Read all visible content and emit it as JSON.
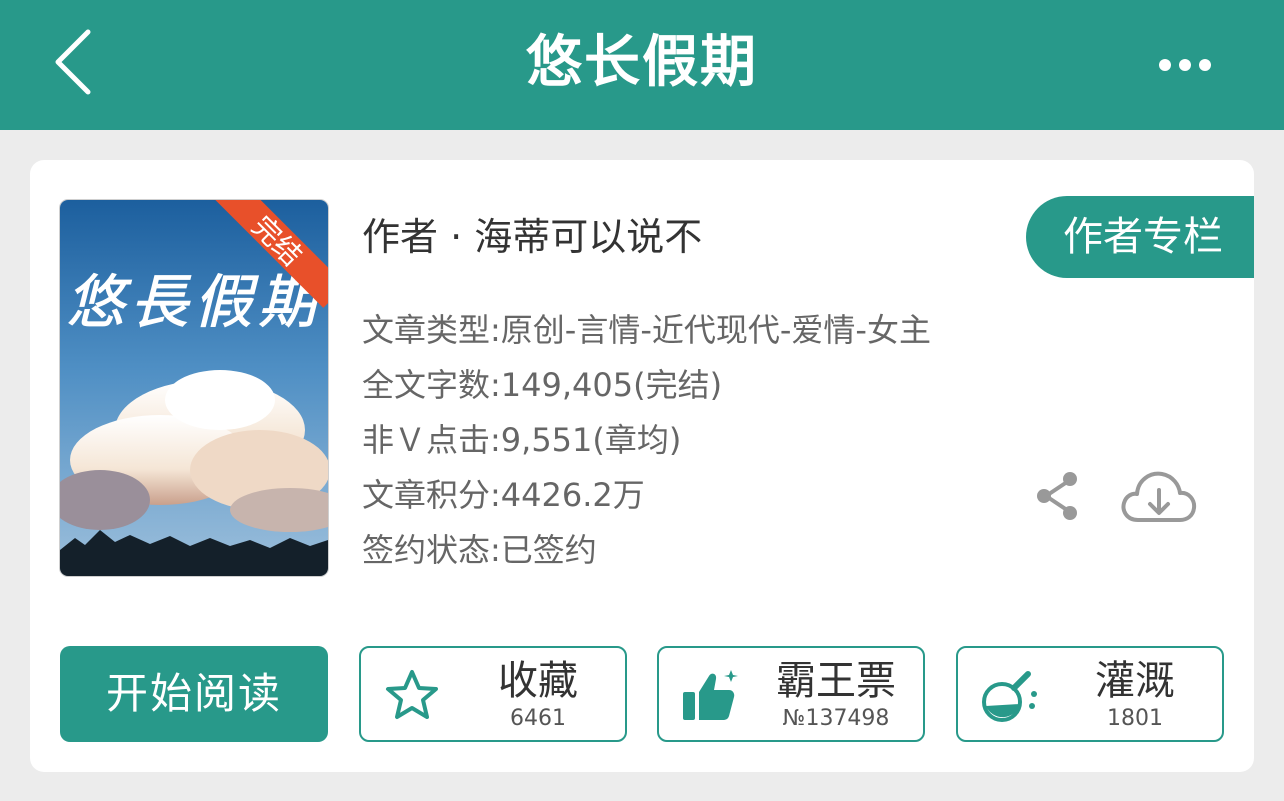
{
  "header": {
    "title": "悠长假期",
    "back_icon": "chevron-left-icon",
    "more_icon": "more-dots-icon"
  },
  "book": {
    "cover_title": "悠長假期",
    "cover_badge": "完结",
    "author_line": "作者 · 海蒂可以说不",
    "author_column_button": "作者专栏",
    "info": {
      "category": "文章类型:原创-言情-近代现代-爱情-女主",
      "word_count": "全文字数:149,405(完结)",
      "clicks": "非Ｖ点击:9,551(章均)",
      "score": "文章积分:4426.2万",
      "sign_status": "签约状态:已签约"
    }
  },
  "actions": {
    "read": "开始阅读",
    "favorite": {
      "label": "收藏",
      "count": "6461",
      "icon": "star-icon"
    },
    "ticket": {
      "label": "霸王票",
      "count": "№137498",
      "icon": "thumbs-up-icon"
    },
    "water": {
      "label": "灌溉",
      "count": "1801",
      "icon": "watering-flask-icon"
    }
  },
  "colors": {
    "accent": "#28998a",
    "badge": "#e8502a",
    "background": "#ececec"
  }
}
